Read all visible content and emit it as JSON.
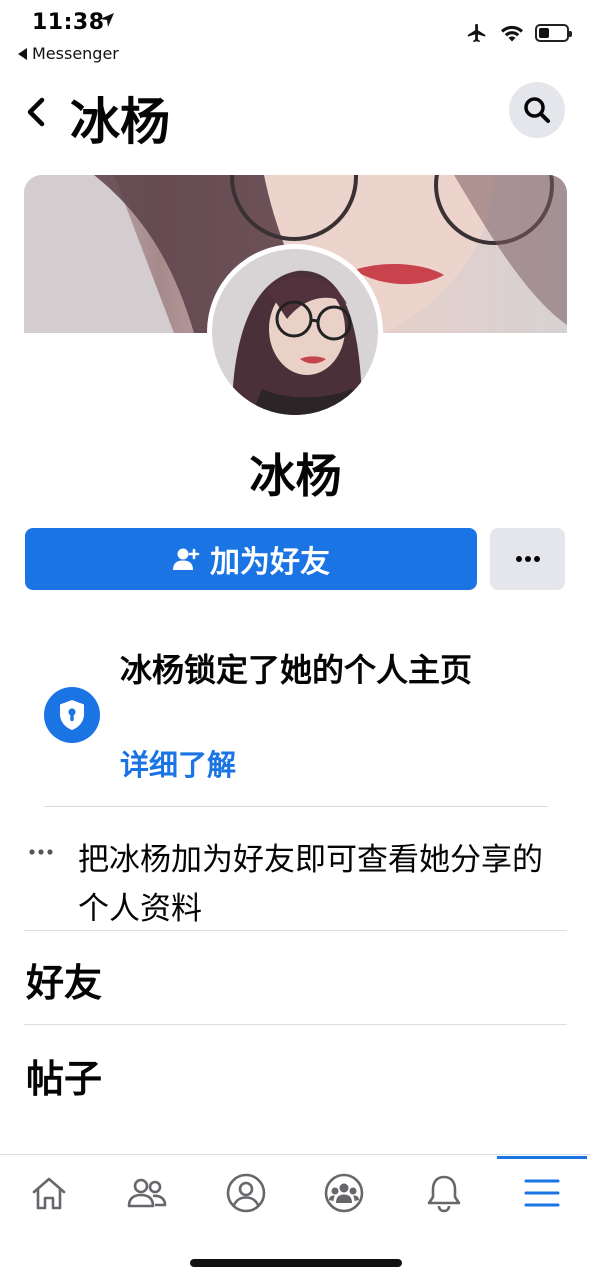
{
  "status_bar": {
    "time": "11:38",
    "back_app": "Messenger",
    "icons": [
      "location-arrow-icon",
      "airplane-icon",
      "wifi-icon",
      "battery-icon"
    ]
  },
  "header": {
    "title": "冰杨",
    "back_icon": "chevron-left-icon",
    "search_icon": "search-icon"
  },
  "profile": {
    "name": "冰杨",
    "add_friend_label": "加为好友",
    "add_friend_icon": "add-user-icon",
    "more_icon": "more-dots-icon"
  },
  "lock_notice": {
    "title": "冰杨锁定了她的个人主页",
    "link": "详细了解",
    "icon": "shield-lock-icon"
  },
  "info": {
    "text": "把冰杨加为好友即可查看她分享的个人资料"
  },
  "sections": {
    "friends": "好友",
    "posts": "帖子"
  },
  "tabbar": {
    "active": "menu",
    "items": [
      "home-icon",
      "friends-icon",
      "profile-icon",
      "groups-icon",
      "bell-icon",
      "menu-icon"
    ]
  },
  "colors": {
    "accent": "#1b74e4",
    "secondary_button": "#e4e6eb",
    "divider": "#dadde1"
  }
}
